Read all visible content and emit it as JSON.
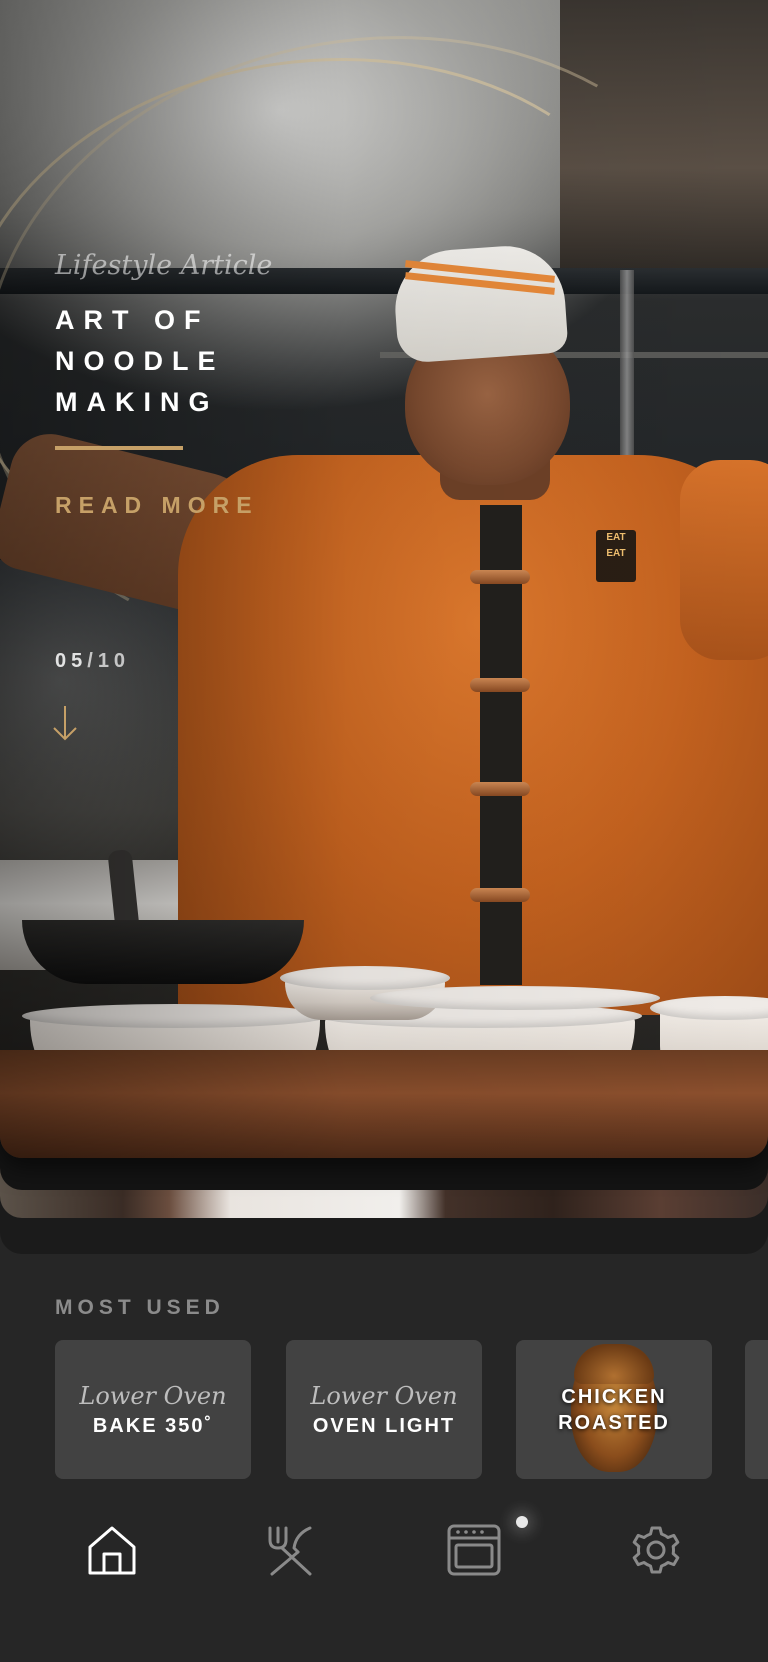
{
  "hero": {
    "eyebrow": "Lifestyle Article",
    "title_lines": [
      "ART OF",
      "NOODLE",
      "MAKING"
    ],
    "cta": "READ MORE",
    "pager": {
      "current": "05",
      "separator": "/",
      "total": "10"
    },
    "accent_color": "#c6a067",
    "uniform_logo_text": "EAT EAT"
  },
  "most_used": {
    "label": "MOST USED",
    "tiles": [
      {
        "subtitle": "Lower Oven",
        "title": "BAKE 350˚"
      },
      {
        "subtitle": "Lower Oven",
        "title": "OVEN LIGHT"
      },
      {
        "title_lines": [
          "CHICKEN",
          "ROASTED"
        ]
      }
    ]
  },
  "nav": {
    "items": [
      {
        "icon": "home-icon",
        "active": true
      },
      {
        "icon": "utensils-icon",
        "active": false
      },
      {
        "icon": "oven-icon",
        "active": false
      },
      {
        "icon": "gear-icon",
        "active": false
      }
    ],
    "active_color": "#ffffff",
    "inactive_color": "#8a8a8a"
  }
}
